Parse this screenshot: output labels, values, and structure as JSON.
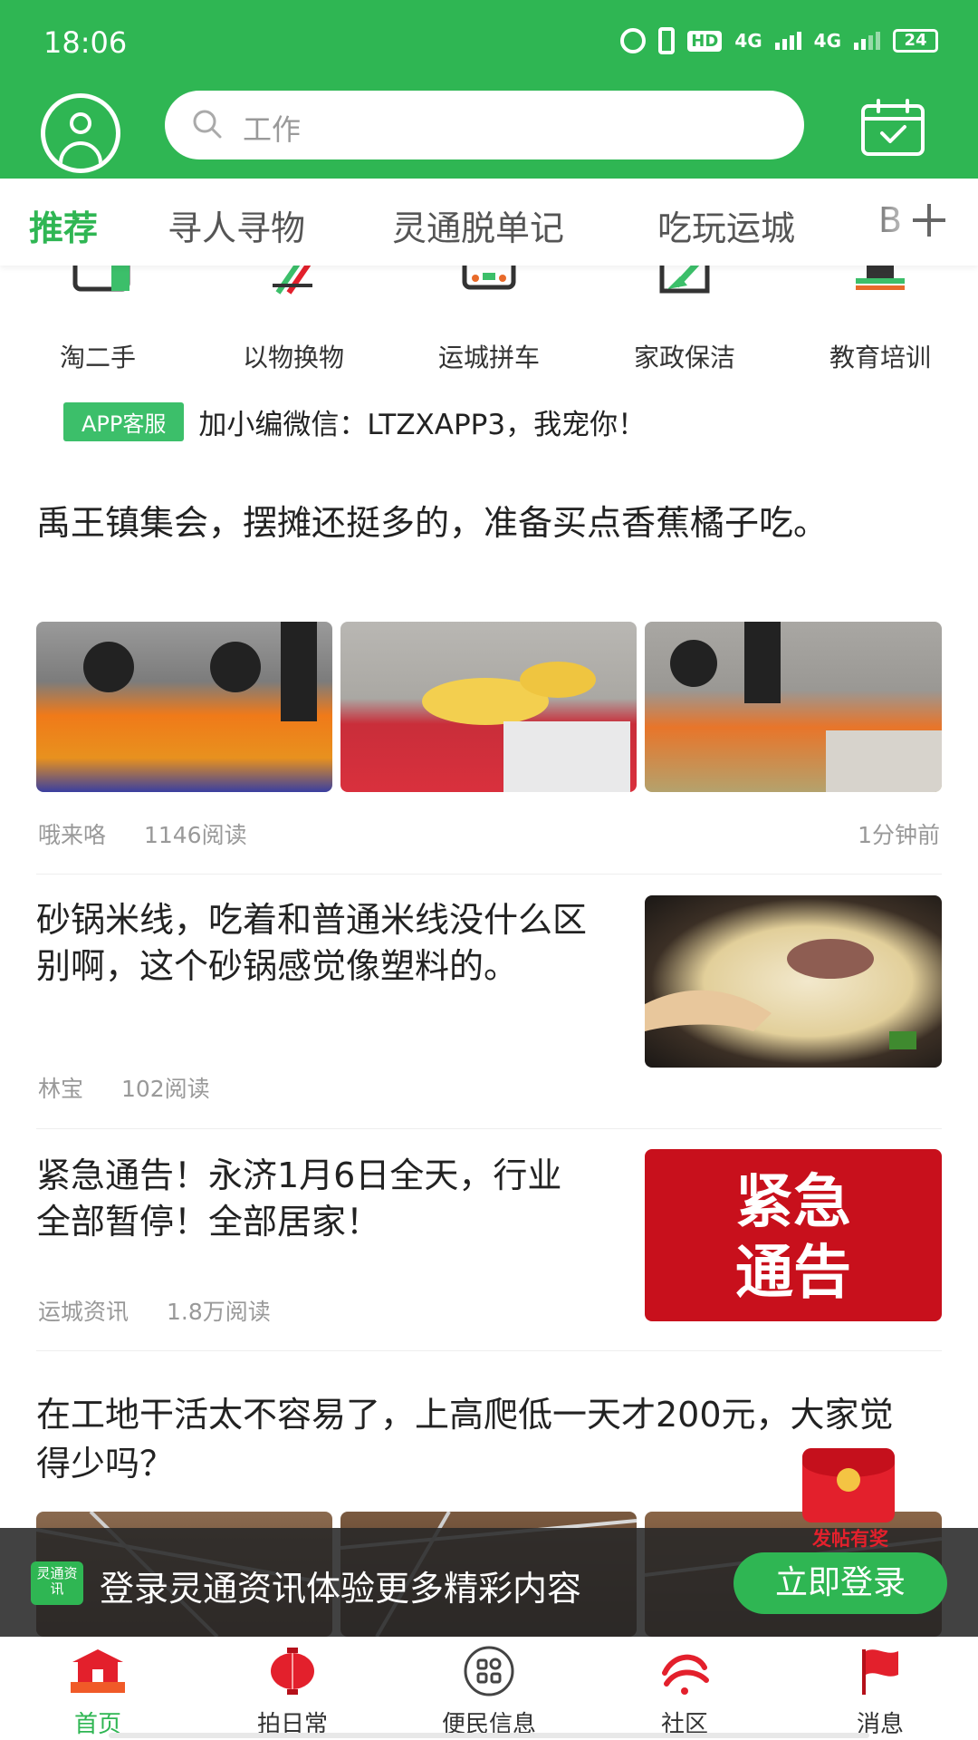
{
  "status_bar": {
    "time": "18:06",
    "network_1": "4G",
    "network_2": "4G",
    "hd": "HD",
    "battery": "24"
  },
  "header": {
    "search_placeholder": "工作"
  },
  "tabs": [
    "推荐",
    "寻人寻物",
    "灵通脱单记",
    "吃玩运城",
    "B"
  ],
  "categories": [
    "淘二手",
    "以物换物",
    "运城拼车",
    "家政保洁",
    "教育培训"
  ],
  "notice": {
    "badge": "APP客服",
    "text": "加小编微信：LTZXAPP3，我宠你！"
  },
  "articles": [
    {
      "title": "禹王镇集会，摆摊还挺多的，准备买点香蕉橘子吃。",
      "author": "哦来咯",
      "reads": "1146阅读",
      "time": "1分钟前"
    },
    {
      "title": "砂锅米线，吃着和普通米线没什么区别啊，这个砂锅感觉像塑料的。",
      "author": "林宝",
      "reads": "102阅读"
    },
    {
      "title": "紧急通告！永济1月6日全天，行业全部暂停！全部居家！",
      "author": "运城资讯",
      "reads": "1.8万阅读",
      "image_text": [
        "紧急",
        "通告"
      ]
    },
    {
      "title": "在工地干活太不容易了，上高爬低一天才200元，大家觉得少吗？"
    }
  ],
  "login_bar": {
    "logo_text": "灵通资讯",
    "message": "登录灵通资讯体验更多精彩内容",
    "button": "立即登录"
  },
  "red_packet": {
    "label": "发帖有奖"
  },
  "bottom_nav": [
    {
      "label": "首页",
      "icon": "home-gate-icon"
    },
    {
      "label": "拍日常",
      "icon": "lantern-icon"
    },
    {
      "label": "便民信息",
      "icon": "grid-apps-icon"
    },
    {
      "label": "社区",
      "icon": "community-icon"
    },
    {
      "label": "消息",
      "icon": "flag-message-icon"
    }
  ],
  "colors": {
    "brand_green": "#2fb653",
    "accent_red": "#e3202c"
  }
}
